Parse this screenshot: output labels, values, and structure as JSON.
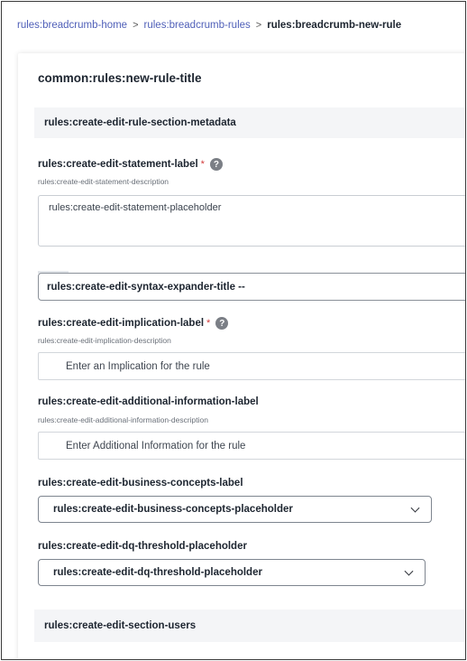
{
  "breadcrumb": {
    "home": "rules:breadcrumb-home",
    "rules": "rules:breadcrumb-rules",
    "current": "rules:breadcrumb-new-rule",
    "separator": ">"
  },
  "page": {
    "title": "common:rules:new-rule-title"
  },
  "sections": {
    "metadata": "rules:create-edit-rule-section-metadata",
    "users": "rules:create-edit-section-users"
  },
  "statement": {
    "label": "rules:create-edit-statement-label",
    "required_mark": "*",
    "help": "?",
    "description": "rules:create-edit-statement-description",
    "placeholder": "rules:create-edit-statement-placeholder"
  },
  "syntax_expander": {
    "title": "rules:create-edit-syntax-expander-title --"
  },
  "implication": {
    "label": "rules:create-edit-implication-label",
    "required_mark": "*",
    "help": "?",
    "description": "rules:create-edit-implication-description",
    "placeholder": "Enter an Implication for the rule"
  },
  "additional_information": {
    "label": "rules:create-edit-additional-information-label",
    "description": "rules:create-edit-additional-information-description",
    "placeholder": "Enter Additional Information for the rule"
  },
  "business_concepts": {
    "label": "rules:create-edit-business-concepts-label",
    "selected": "rules:create-edit-business-concepts-placeholder"
  },
  "dq_threshold": {
    "label": "rules:create-edit-dq-threshold-placeholder",
    "selected": "rules:create-edit-dq-threshold-placeholder"
  },
  "icons": {
    "help": "question-circle-icon",
    "dropdown": "chevron-down-icon"
  },
  "colors": {
    "link": "#4f5fb8",
    "required": "#d23b3b",
    "section_bg": "#f4f5f7"
  }
}
